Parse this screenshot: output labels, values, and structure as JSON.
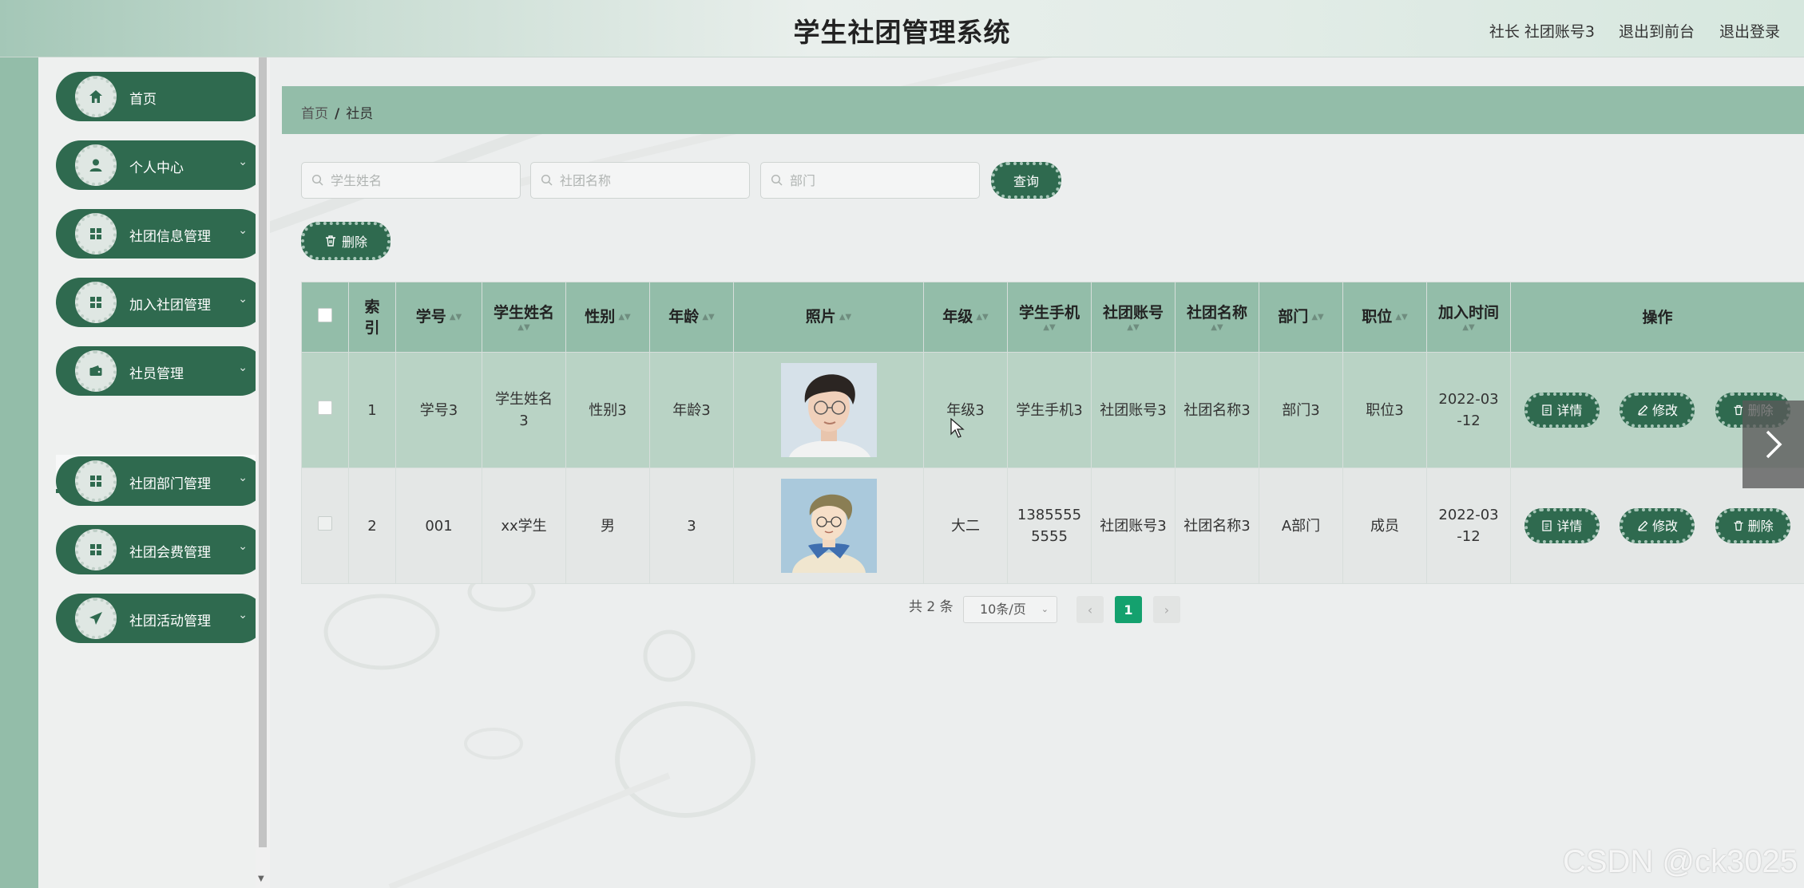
{
  "header": {
    "title": "学生社团管理系统",
    "user": "社长 社团账号3",
    "front_link": "退出到前台",
    "logout_link": "退出登录"
  },
  "sidebar": {
    "items": [
      {
        "label": "首页",
        "icon": "home-icon"
      },
      {
        "label": "个人中心",
        "icon": "user-icon"
      },
      {
        "label": "社团信息管理",
        "icon": "grid-icon"
      },
      {
        "label": "加入社团管理",
        "icon": "grid-icon"
      },
      {
        "label": "社员管理",
        "icon": "wallet-icon"
      },
      {
        "label": "社团部门管理",
        "icon": "grid-icon"
      },
      {
        "label": "社团会费管理",
        "icon": "grid-icon"
      },
      {
        "label": "社团活动管理",
        "icon": "send-icon"
      }
    ],
    "submenu_label": "社员"
  },
  "breadcrumb": {
    "home": "首页",
    "separator": "/",
    "current": "社员"
  },
  "search": {
    "student_name_placeholder": "学生姓名",
    "club_name_placeholder": "社团名称",
    "department_placeholder": "部门",
    "query_label": "查询",
    "delete_label": "删除"
  },
  "table": {
    "headers": {
      "index": "索引",
      "student_no": "学号",
      "student_name": "学生姓名",
      "gender": "性别",
      "age": "年龄",
      "photo": "照片",
      "grade": "年级",
      "phone": "学生手机",
      "club_account": "社团账号",
      "club_name": "社团名称",
      "department": "部门",
      "position": "职位",
      "join_time": "加入时间",
      "actions": "操作"
    },
    "rows": [
      {
        "index": "1",
        "student_no": "学号3",
        "student_name": "学生姓名3",
        "gender": "性别3",
        "age": "年龄3",
        "grade": "年级3",
        "phone": "学生手机3",
        "club_account": "社团账号3",
        "club_name": "社团名称3",
        "department": "部门3",
        "position": "职位3",
        "join_time": "2022-03-12"
      },
      {
        "index": "2",
        "student_no": "001",
        "student_name": "xx学生",
        "gender": "男",
        "age": "3",
        "grade": "大二",
        "phone": "13855555555",
        "club_account": "社团账号3",
        "club_name": "社团名称3",
        "department": "A部门",
        "position": "成员",
        "join_time": "2022-03-12"
      }
    ],
    "actions": {
      "detail": "详情",
      "edit": "修改",
      "delete": "删除"
    }
  },
  "pagination": {
    "total": "共 2 条",
    "page_size": "10条/页",
    "current_page": "1"
  },
  "watermark": "CSDN @ck3025",
  "colors": {
    "accent": "#2f6a4f",
    "table_header": "#93bda9",
    "active_page": "#14a16e"
  }
}
